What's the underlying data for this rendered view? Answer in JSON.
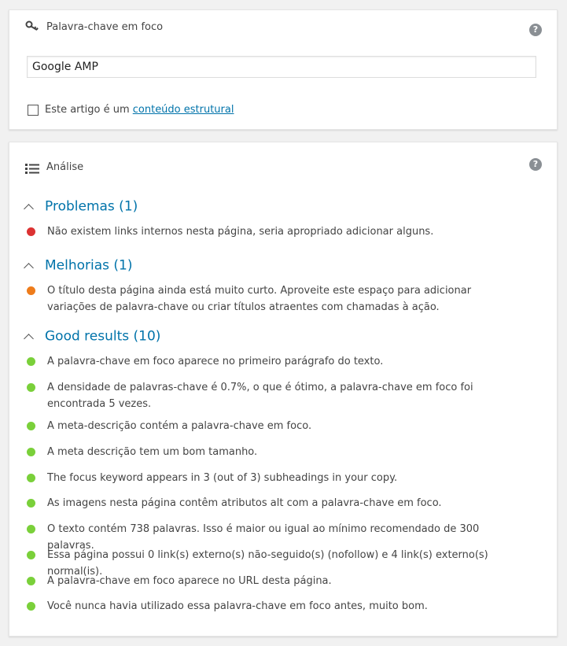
{
  "focus": {
    "label": "Palavra-chave em foco",
    "keyword_value": "Google AMP",
    "cornerstone_prefix": "Este artigo é um ",
    "cornerstone_link": "conteúdo estrutural",
    "help": "?"
  },
  "analysis": {
    "label": "Análise",
    "help": "?",
    "problems": {
      "title": "Problemas (1)",
      "items": [
        "Não existem links internos nesta página, seria apropriado adicionar alguns."
      ]
    },
    "improvements": {
      "title": "Melhorias (1)",
      "items": [
        "O título desta página ainda está muito curto. Aproveite este espaço para adicionar variações de palavra-chave ou criar títulos atraentes com chamadas à ação."
      ]
    },
    "good": {
      "title": "Good results (10)",
      "items": [
        "A palavra-chave em foco aparece no primeiro parágrafo do texto.",
        "A densidade de palavras-chave é 0.7%, o que é ótimo, a palavra-chave em foco foi encontrada 5 vezes.",
        "A meta-descrição contém a palavra-chave em foco.",
        "A meta descrição tem um bom tamanho.",
        "The focus keyword appears in 3 (out of 3) subheadings in your copy.",
        "As imagens nesta página contêm atributos alt com a palavra-chave em foco.",
        "O texto contém 738 palavras. Isso é maior ou igual ao mínimo recomendado de 300 palavras.",
        "Essa página possui 0 link(s) externo(s) não-seguido(s) (nofollow) e 4 link(s) externo(s) normal(is).",
        "A palavra-chave em foco aparece no URL desta página.",
        "Você nunca havia utilizado essa palavra-chave em foco antes, muito bom."
      ]
    }
  },
  "colors": {
    "bad": "#dc3232",
    "ok": "#ee7c1b",
    "good": "#7ad03a",
    "link": "#0073aa"
  },
  "icons": {
    "focus": "key-icon",
    "analysis": "list-icon",
    "help": "help-icon",
    "section": "chevron-up-icon"
  }
}
